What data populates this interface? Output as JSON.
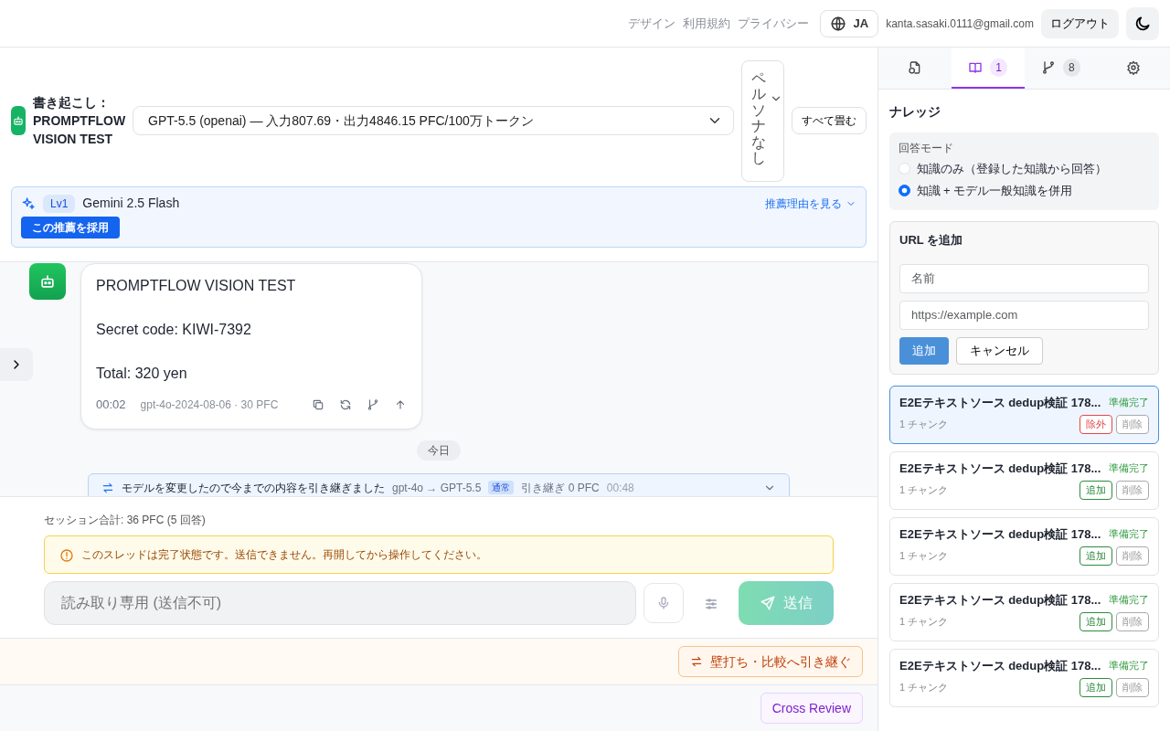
{
  "header": {
    "links": [
      "デザイン",
      "利用規約",
      "プライバシー"
    ],
    "language": "JA",
    "email": "kanta.sasaki.0111@gmail.com",
    "logout": "ログアウト"
  },
  "conversation": {
    "title": "書き起こし：PROMPTFLOW VISION TEST",
    "model_select": "GPT-5.5 (openai) — 入力807.69・出力4846.15 PFC/100万トークン",
    "persona": "ペルソナなし",
    "collapse_all": "すべて畳む"
  },
  "recommendation": {
    "level": "Lv1",
    "model": "Gemini 2.5 Flash",
    "reason_link": "推薦理由を見る",
    "adopt": "この推薦を採用"
  },
  "messages": [
    {
      "paragraphs": [
        "PROMPTFLOW VISION TEST",
        "Secret code: KIWI-7392",
        "Total: 320 yen"
      ],
      "time": "00:02",
      "meta": "gpt-4o-2024-08-06 · 30 PFC"
    }
  ],
  "date_divider": "今日",
  "model_change": {
    "text": "モデルを変更したので今までの内容を引き継ぎました",
    "models": "gpt-4o → GPT-5.5",
    "tag": "通常",
    "carry": "引き継ぎ 0 PFC",
    "time": "00:48"
  },
  "composer": {
    "session_total": "セッション合計: 36 PFC (5 回答)",
    "warning": "このスレッドは完了状態です。送信できません。再開してから操作してください。",
    "placeholder": "読み取り専用 (送信不可)",
    "send": "送信",
    "disabled": true
  },
  "handoff_button": "壁打ち・比較へ引き継ぐ",
  "cross_review": "Cross Review",
  "panel": {
    "tabs": [
      {
        "kind": "files",
        "selected": false
      },
      {
        "kind": "knowledge",
        "count": "1",
        "selected": true
      },
      {
        "kind": "branches",
        "count": "8",
        "selected": false
      },
      {
        "kind": "settings",
        "selected": false
      }
    ],
    "heading": "ナレッジ",
    "answer_mode": {
      "label": "回答モード",
      "options": [
        {
          "label": "知識のみ（登録した知識から回答）",
          "selected": false
        },
        {
          "label": "知識 + モデル一般知識を併用",
          "selected": true
        }
      ]
    },
    "url_form": {
      "title": "URL を追加",
      "name_placeholder": "名前",
      "url_placeholder": "https://example.com",
      "submit": "追加",
      "cancel": "キャンセル"
    },
    "items": [
      {
        "title": "E2Eテキストソース dedup検証 178...",
        "status": "準備完了",
        "chunks": "1 チャンク",
        "selected": true,
        "action": {
          "kind": "exclude",
          "label": "除外"
        },
        "delete": "削除"
      },
      {
        "title": "E2Eテキストソース dedup検証 178...",
        "status": "準備完了",
        "chunks": "1 チャンク",
        "selected": false,
        "action": {
          "kind": "include",
          "label": "追加"
        },
        "delete": "削除"
      },
      {
        "title": "E2Eテキストソース dedup検証 178...",
        "status": "準備完了",
        "chunks": "1 チャンク",
        "selected": false,
        "action": {
          "kind": "include",
          "label": "追加"
        },
        "delete": "削除"
      },
      {
        "title": "E2Eテキストソース dedup検証 178...",
        "status": "準備完了",
        "chunks": "1 チャンク",
        "selected": false,
        "action": {
          "kind": "include",
          "label": "追加"
        },
        "delete": "削除"
      },
      {
        "title": "E2Eテキストソース dedup検証 178...",
        "status": "準備完了",
        "chunks": "1 チャンク",
        "selected": false,
        "action": {
          "kind": "include",
          "label": "追加"
        },
        "delete": "削除"
      }
    ]
  }
}
